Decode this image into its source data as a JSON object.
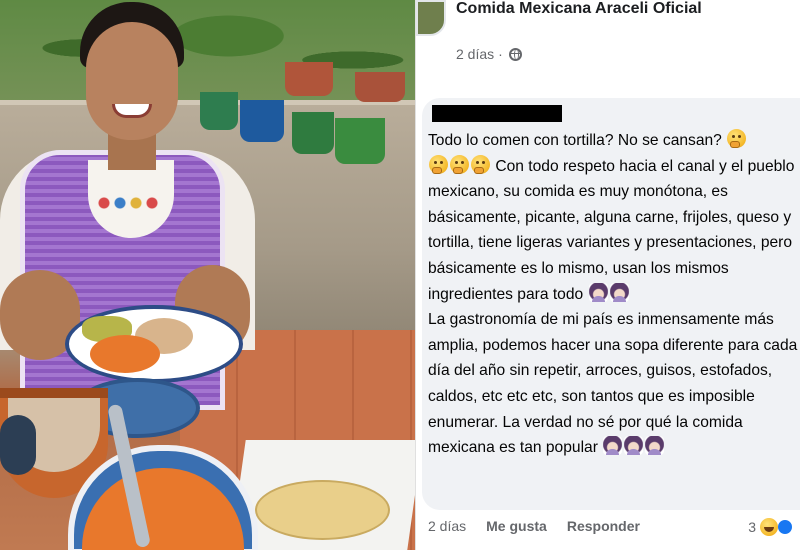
{
  "post": {
    "page_name": "Comida Mexicana Araceli Oficial",
    "timestamp": "2 días",
    "separator": "·",
    "privacy_icon": "globe-icon"
  },
  "comment": {
    "author_redacted": true,
    "paragraphs": [
      "Todo lo comen con tortilla? No se cansan?",
      "Con todo respeto hacia el canal y el pueblo mexicano, su comida es muy monótona, es básicamente, picante, alguna carne, frijoles, queso y tortilla, tiene ligeras variantes y presentaciones, pero básicamente es lo mismo, usan los mismos ingredientes para todo",
      "La gastronomía de mi país es inmensamente más amplia, podemos hacer una sopa diferente para cada día del año sin repetir, arroces, guisos, estofados, caldos, etc etc etc, son tantos que es imposible enumerar. La verdad no sé por qué la comida mexicana es tan popular"
    ],
    "emoji_icons": [
      "thinking-face-icon",
      "woman-facepalming-icon"
    ]
  },
  "comment_actions": {
    "time": "2 días",
    "like_label": "Me gusta",
    "reply_label": "Responder",
    "reaction_count": "3",
    "reaction_icons": [
      "haha-icon",
      "like-icon"
    ]
  },
  "colors": {
    "fb_text": "#050505",
    "fb_meta": "#65676b",
    "bubble_bg": "#f0f2f5",
    "like_blue": "#1877f2"
  }
}
